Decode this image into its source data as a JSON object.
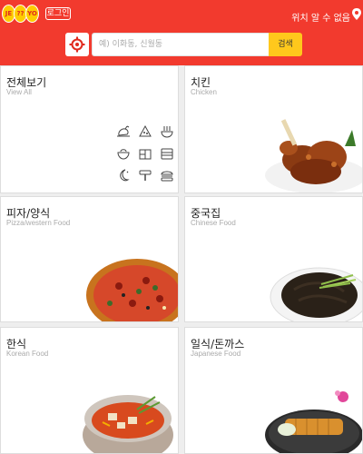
{
  "header": {
    "logo": [
      "JE",
      "??",
      "YO"
    ],
    "login_label": "로그인",
    "location_text": "위치 알 수 없음",
    "search_placeholder": "예) 이화동, 신월동",
    "search_button": "검색"
  },
  "categories": [
    {
      "title": "전체보기",
      "subtitle": "View All"
    },
    {
      "title": "치킨",
      "subtitle": "Chicken"
    },
    {
      "title": "피자/양식",
      "subtitle": "Pizza/western Food"
    },
    {
      "title": "중국집",
      "subtitle": "Chinese Food"
    },
    {
      "title": "한식",
      "subtitle": "Korean Food"
    },
    {
      "title": "일식/돈까스",
      "subtitle": "Japanese Food"
    }
  ],
  "icons": [
    "chicken-icon",
    "pizza-icon",
    "noodle-icon",
    "bowl-icon",
    "lunchbox-icon",
    "bento-icon",
    "night-icon",
    "burger-stand-icon",
    "burger-icon"
  ],
  "colors": {
    "header": "#f23a2e",
    "search_button": "#ffc81c"
  }
}
